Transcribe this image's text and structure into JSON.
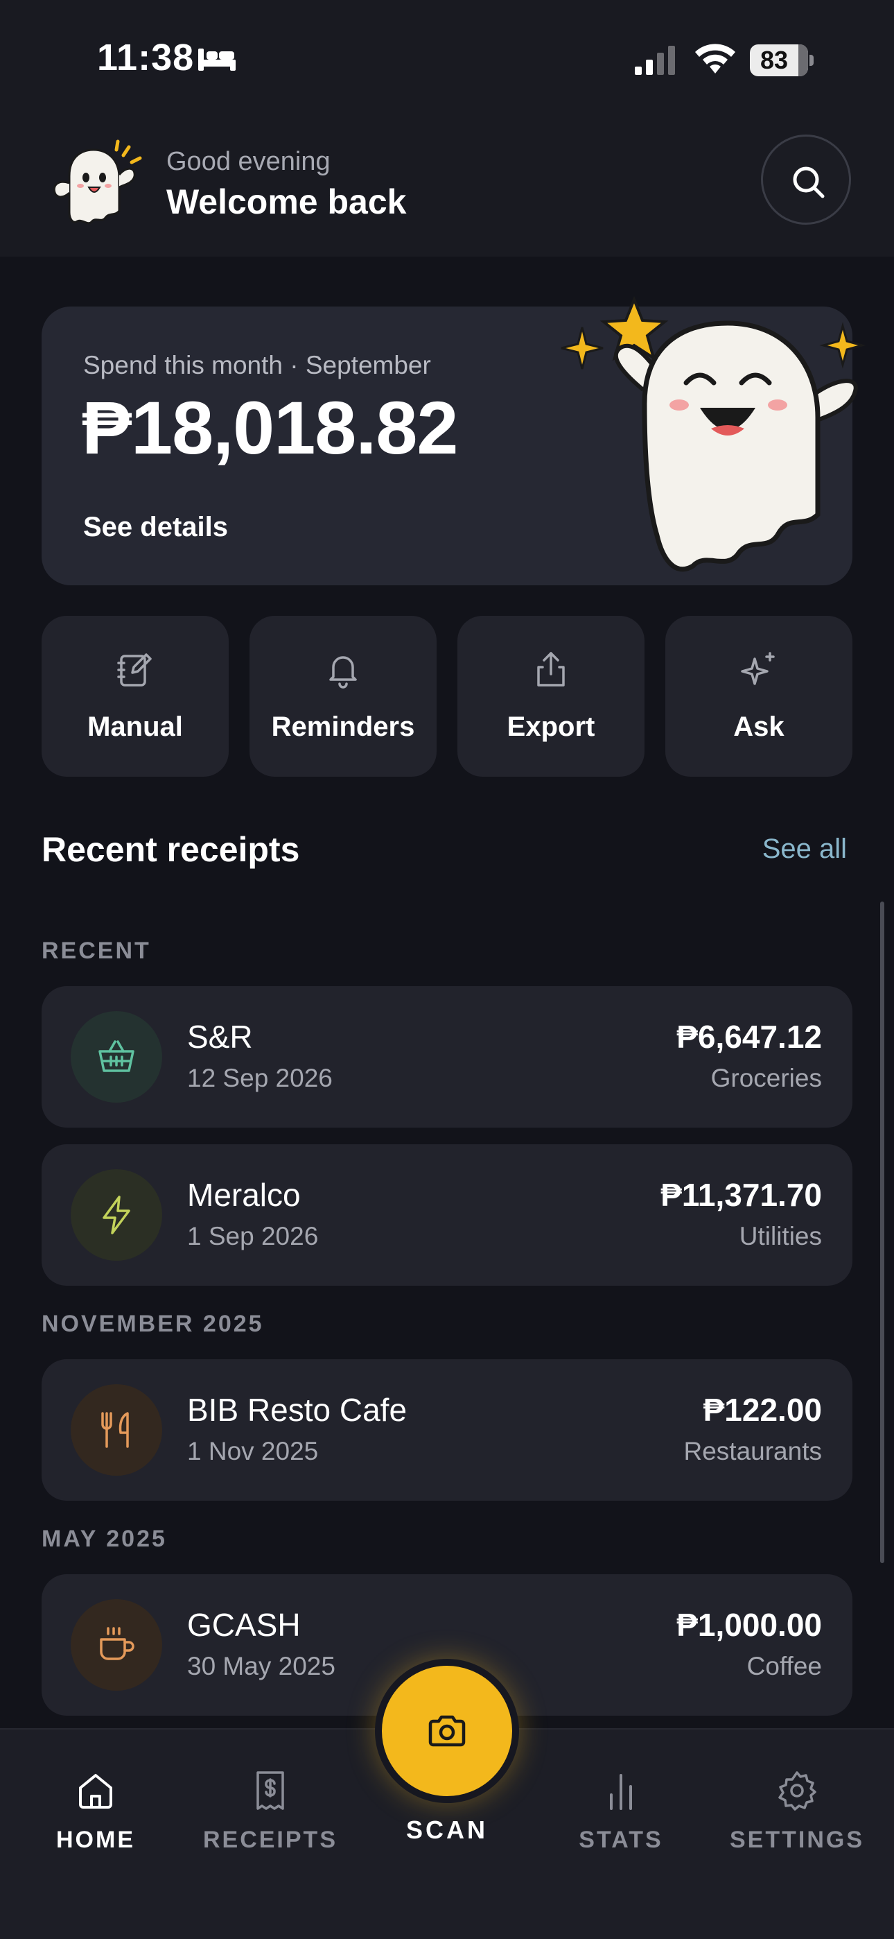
{
  "status_bar": {
    "time": "11:38",
    "battery": "83",
    "icons": [
      "sleep-icon",
      "signal-icon",
      "wifi-icon",
      "battery-icon"
    ]
  },
  "header": {
    "greeting": "Good evening",
    "welcome": "Welcome back",
    "avatar_icon": "ghost-mascot-icon",
    "search_icon": "search-icon"
  },
  "spend_card": {
    "label": "Spend this month · September",
    "amount": "₱18,018.82",
    "details_link": "See details",
    "illustration": "happy-ghost-with-stars"
  },
  "actions": [
    {
      "label": "Manual",
      "icon": "notebook-edit-icon"
    },
    {
      "label": "Reminders",
      "icon": "bell-icon"
    },
    {
      "label": "Export",
      "icon": "share-icon"
    },
    {
      "label": "Ask",
      "icon": "sparkles-icon"
    }
  ],
  "recent": {
    "title": "Recent receipts",
    "see_all": "See all",
    "groups": [
      {
        "label": "RECENT",
        "items": [
          {
            "name": "S&R",
            "date": "12 Sep 2026",
            "amount": "₱6,647.12",
            "category": "Groceries",
            "icon": "basket-icon",
            "color": "#5fc2a0"
          },
          {
            "name": "Meralco",
            "date": "1 Sep 2026",
            "amount": "₱11,371.70",
            "category": "Utilities",
            "icon": "lightning-icon",
            "color": "#c3d35a"
          }
        ]
      },
      {
        "label": "NOVEMBER 2025",
        "items": [
          {
            "name": "BIB Resto Cafe",
            "date": "1 Nov 2025",
            "amount": "₱122.00",
            "category": "Restaurants",
            "icon": "utensils-icon",
            "color": "#e59a5a"
          }
        ]
      },
      {
        "label": "MAY 2025",
        "items": [
          {
            "name": "GCASH",
            "date": "30 May 2025",
            "amount": "₱1,000.00",
            "category": "Coffee",
            "icon": "coffee-cup-icon",
            "color": "#e59a5a"
          }
        ]
      }
    ]
  },
  "bottom_nav": {
    "items": [
      {
        "label": "HOME",
        "icon": "home-icon",
        "active": true
      },
      {
        "label": "RECEIPTS",
        "icon": "receipt-icon",
        "active": false
      },
      {
        "label": "STATS",
        "icon": "bar-chart-icon",
        "active": false
      },
      {
        "label": "SETTINGS",
        "icon": "gear-icon",
        "active": false
      }
    ],
    "scan": {
      "label": "SCAN",
      "icon": "camera-icon"
    }
  },
  "colors": {
    "background": "#12131a",
    "card": "#22232c",
    "accent": "#f3b81c",
    "link": "#8ab7cc"
  }
}
